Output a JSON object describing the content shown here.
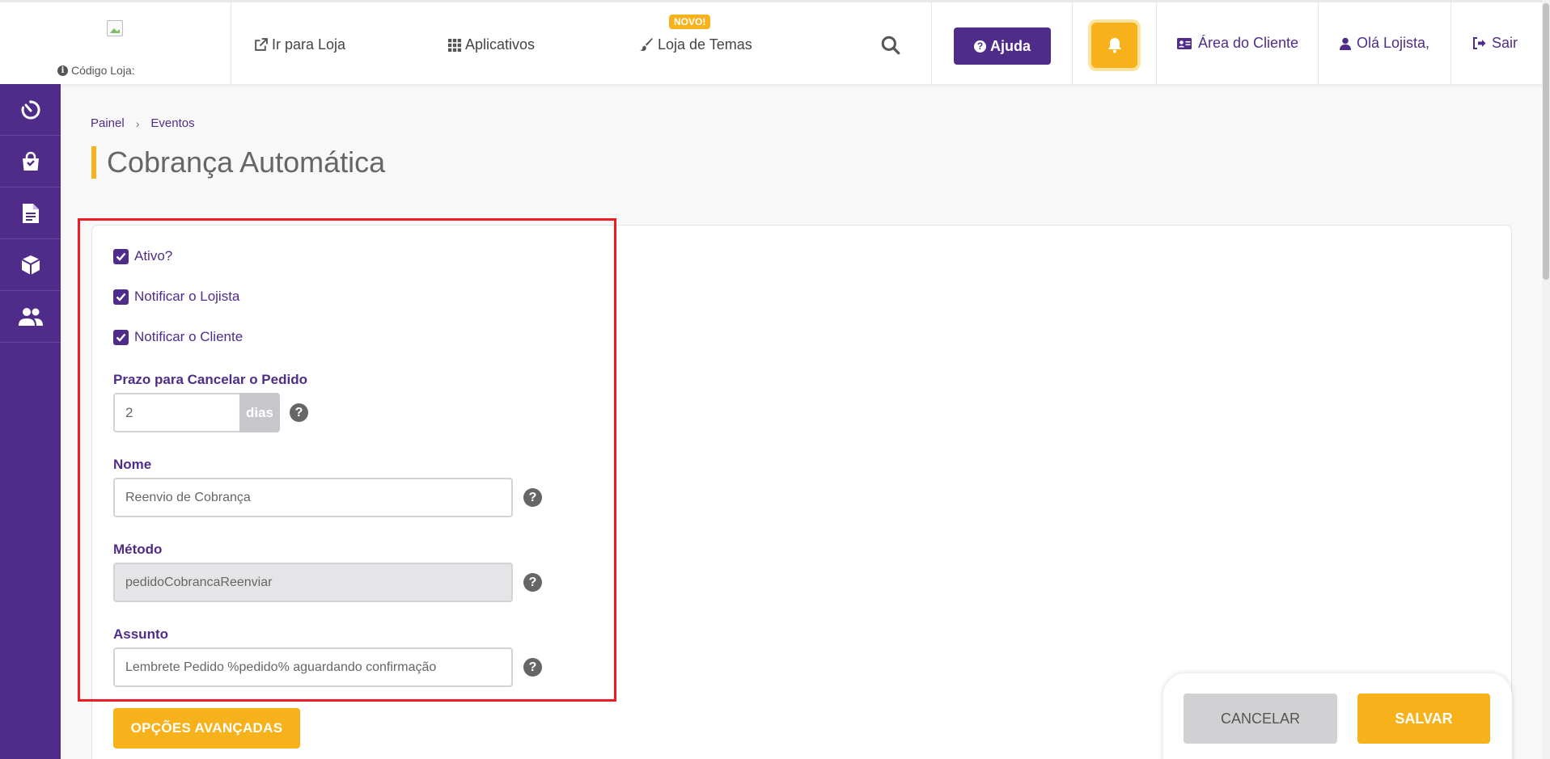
{
  "header": {
    "store_code_label": "Código Loja:",
    "nav": {
      "go_to_store": "Ir para Loja",
      "apps": "Aplicativos",
      "themes_store": "Loja de Temas",
      "new_badge": "NOVO!"
    },
    "help_label": "Ajuda",
    "client_area": "Área do Cliente",
    "greeting": "Olá Lojista,",
    "logout": "Sair"
  },
  "sidebar": {
    "items": [
      {
        "icon": "dashboard-timer-icon"
      },
      {
        "icon": "shopping-bag-icon"
      },
      {
        "icon": "document-icon"
      },
      {
        "icon": "box-icon"
      },
      {
        "icon": "users-icon"
      }
    ]
  },
  "breadcrumb": {
    "items": [
      "Painel",
      "Eventos"
    ],
    "separator": "›"
  },
  "page": {
    "title": "Cobrança Automática"
  },
  "form": {
    "checkboxes": [
      {
        "label": "Ativo?",
        "checked": true
      },
      {
        "label": "Notificar o Lojista",
        "checked": true
      },
      {
        "label": "Notificar o Cliente",
        "checked": true
      }
    ],
    "deadline": {
      "label": "Prazo para Cancelar o Pedido",
      "value": "2",
      "unit": "dias"
    },
    "name": {
      "label": "Nome",
      "value": "Reenvio de Cobrança"
    },
    "method": {
      "label": "Método",
      "value": "pedidoCobrancaReenviar"
    },
    "subject": {
      "label": "Assunto",
      "value": "Lembrete Pedido %pedido% aguardando confirmação"
    },
    "help_glyph": "?",
    "advanced_label": "OPÇÕES AVANÇADAS"
  },
  "actions": {
    "cancel": "CANCELAR",
    "save": "SALVAR"
  },
  "colors": {
    "primary": "#4f2c8a",
    "accent": "#f7b21b",
    "highlight": "#ee1c25"
  }
}
